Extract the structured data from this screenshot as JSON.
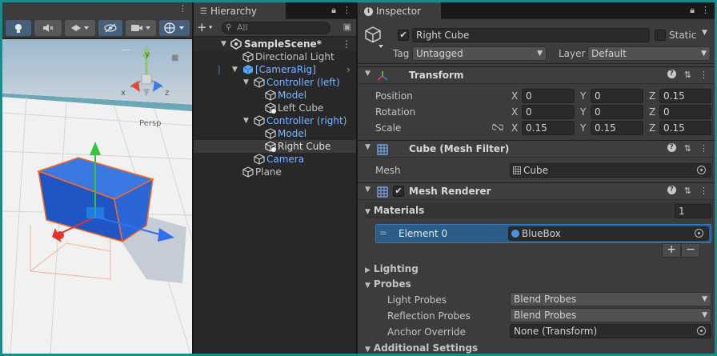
{
  "scene": {
    "toolbar_more": "⋮",
    "persp_label": "Persp",
    "gizmo_axes": {
      "x": "x",
      "y": "y",
      "z": "z"
    }
  },
  "hierarchy": {
    "tab_title": "Hierarchy",
    "search_placeholder": "All",
    "add_button": "+",
    "items": [
      {
        "label": "SampleScene*",
        "depth": 0,
        "type": "scene"
      },
      {
        "label": "Directional Light",
        "depth": 1,
        "type": "object"
      },
      {
        "label": "[CameraRig]",
        "depth": 1,
        "type": "prefab"
      },
      {
        "label": "Controller (left)",
        "depth": 2,
        "type": "prefab-child"
      },
      {
        "label": "Model",
        "depth": 3,
        "type": "prefab-child"
      },
      {
        "label": "Left Cube",
        "depth": 3,
        "type": "object-added"
      },
      {
        "label": "Controller (right)",
        "depth": 2,
        "type": "prefab-child"
      },
      {
        "label": "Model",
        "depth": 3,
        "type": "prefab-child"
      },
      {
        "label": "Right Cube",
        "depth": 3,
        "type": "object-added",
        "selected": true
      },
      {
        "label": "Camera",
        "depth": 2,
        "type": "prefab-child"
      },
      {
        "label": "Plane",
        "depth": 1,
        "type": "object"
      }
    ]
  },
  "inspector": {
    "tab_title": "Inspector",
    "object_name": "Right Cube",
    "static_label": "Static",
    "tag_label": "Tag",
    "tag_value": "Untagged",
    "layer_label": "Layer",
    "layer_value": "Default",
    "transform": {
      "title": "Transform",
      "position_label": "Position",
      "rotation_label": "Rotation",
      "scale_label": "Scale",
      "position": {
        "x": "0",
        "y": "0",
        "z": "0.15"
      },
      "rotation": {
        "x": "0",
        "y": "0",
        "z": "0"
      },
      "scale": {
        "x": "0.15",
        "y": "0.15",
        "z": "0.15"
      }
    },
    "mesh_filter": {
      "title": "Cube (Mesh Filter)",
      "mesh_label": "Mesh",
      "mesh_value": "Cube"
    },
    "mesh_renderer": {
      "title": "Mesh Renderer",
      "materials_label": "Materials",
      "materials_count": "1",
      "element_label": "Element 0",
      "element_value": "BlueBox",
      "add_button": "+",
      "remove_button": "−",
      "lighting_label": "Lighting",
      "probes_label": "Probes",
      "light_probes_label": "Light Probes",
      "light_probes_value": "Blend Probes",
      "reflection_probes_label": "Reflection Probes",
      "reflection_probes_value": "Blend Probes",
      "anchor_override_label": "Anchor Override",
      "anchor_override_value": "None (Transform)",
      "additional_settings_label": "Additional Settings"
    },
    "axis_letters": {
      "x": "X",
      "y": "Y",
      "z": "Z"
    }
  },
  "colors": {
    "border": "#1d8a8a",
    "selection": "#2c5d87",
    "prefab_blue": "#7fb4ff"
  }
}
